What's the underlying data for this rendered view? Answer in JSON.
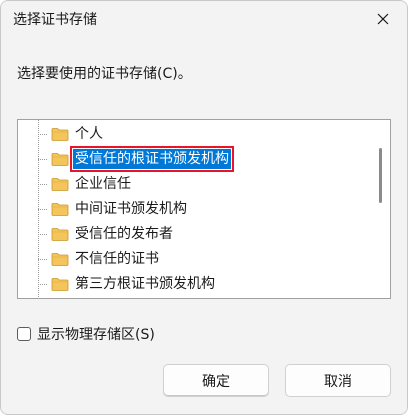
{
  "window": {
    "title": "选择证书存储",
    "close_glyph": "✕"
  },
  "prompt": "选择要使用的证书存储(C)。",
  "tree": {
    "items": [
      {
        "label": "个人",
        "selected": false
      },
      {
        "label": "受信任的根证书颁发机构",
        "selected": true
      },
      {
        "label": "企业信任",
        "selected": false
      },
      {
        "label": "中间证书颁发机构",
        "selected": false
      },
      {
        "label": "受信任的发布者",
        "selected": false
      },
      {
        "label": "不信任的证书",
        "selected": false
      },
      {
        "label": "第三方根证书颁发机构",
        "selected": false
      }
    ]
  },
  "checkbox": {
    "label": "显示物理存储区(S)",
    "checked": false
  },
  "buttons": {
    "ok": "确定",
    "cancel": "取消"
  },
  "colors": {
    "selection": "#0078d7",
    "highlight_outline": "#e8142c",
    "folder": "#f3c55a"
  }
}
